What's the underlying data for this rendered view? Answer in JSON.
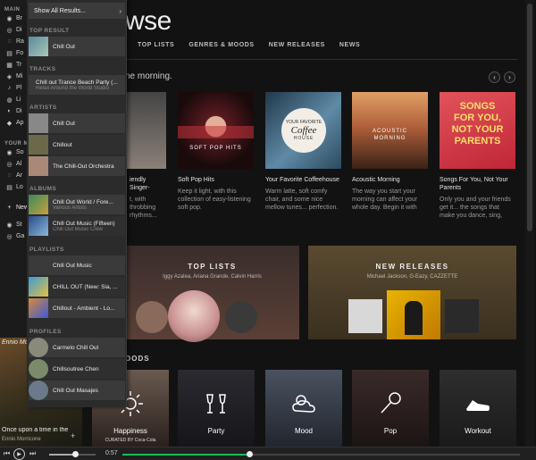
{
  "rail": {
    "main_label": "MAIN",
    "main_items": [
      "Br",
      "Di",
      "Ra",
      "Fo",
      "Tr",
      "Mi",
      "Pl",
      "Li",
      "Di",
      "Ap"
    ],
    "your_music_label": "YOUR M",
    "your_music_items": [
      "So",
      "Al",
      "Ar",
      "Lo"
    ],
    "new_label": "New",
    "extra_items": [
      "St",
      "Ga"
    ]
  },
  "browse": {
    "title": "wse",
    "tabs": [
      "TOP LISTS",
      "GENRES & MOODS",
      "NEW RELEASES",
      "NEWS"
    ],
    "section_heading": "he morning.",
    "prev_icon": "chevron-left-icon",
    "next_icon": "chevron-right-icon"
  },
  "cards": [
    {
      "title": "iendly Singer-",
      "desc": "t, with\nthrobbing\nrhythms...",
      "art_text": "",
      "art_colors": [
        "#2a2a2a",
        "#8a7a6a"
      ]
    },
    {
      "title": "Soft Pop Hits",
      "desc": "Keep it light, with this collection of easy-listening soft pop.",
      "art_text": "SOFT POP HITS",
      "art_colors": [
        "#3a1015",
        "#c8343c"
      ]
    },
    {
      "title": "Your Favorite Coffeehouse",
      "desc": "Warm latte, soft comfy chair, and some nice mellow tunes... perfection.",
      "art_text_top": "YOUR FAVORITE",
      "art_text_mid": "Coffee",
      "art_text_bot": "HOUSE",
      "art_colors": [
        "#1d2e3d",
        "#4a7a9a"
      ]
    },
    {
      "title": "Acoustic Morning",
      "desc": "The way you start your morning can affect your whole day. Begin it with",
      "art_text": "ACOUSTIC MORNING",
      "art_colors": [
        "#3a2418",
        "#c4805a"
      ]
    },
    {
      "title": "Songs For You, Not Your Parents",
      "desc": "Only you and your friends get it... the songs that make you dance, sing,",
      "art_lines": [
        "SONGS",
        "FOR YOU,",
        "NOT YOUR",
        "PARENTS"
      ],
      "art_colors": [
        "#c8253a",
        "#e85a5a"
      ]
    }
  ],
  "banners": [
    {
      "title": "TOP LISTS",
      "sub": "Iggy Azalea, Ariana Grande, Calvin Harris"
    },
    {
      "title": "NEW RELEASES",
      "sub": "Michael Jackson, G-Eazy, CAZZETTE"
    }
  ],
  "moods": {
    "heading": "OODS",
    "items": [
      {
        "label": "Happiness",
        "sub": "CURATED BY Coca-Cola",
        "icon": "sun-icon"
      },
      {
        "label": "Party",
        "icon": "glasses-icon"
      },
      {
        "label": "Mood",
        "icon": "cloud-sun-icon"
      },
      {
        "label": "Pop",
        "icon": "microphone-icon"
      },
      {
        "label": "Workout",
        "icon": "shoe-icon"
      }
    ]
  },
  "panel": {
    "show_all": "Show All Results...",
    "sections": {
      "top_result": "TOP RESULT",
      "tracks": "TRACKS",
      "artists": "ARTISTS",
      "albums": "ALBUMS",
      "playlists": "PLAYLISTS",
      "profiles": "PROFILES"
    },
    "top_result": [
      {
        "t1": "Chill Out",
        "t2": ""
      }
    ],
    "tracks": [
      {
        "t1": "Chill out Trance Beach Party (...",
        "t2": "Relax Around the World Studio"
      }
    ],
    "artists": [
      {
        "t1": "Chill Out"
      },
      {
        "t1": "Chillout"
      },
      {
        "t1": "The Chill-Out Orchestra"
      }
    ],
    "albums": [
      {
        "t1": "Chill Out World / Fore...",
        "t2": "Various Artists"
      },
      {
        "t1": "Chill Out Music (Fifteen)",
        "t2": "Chill Out Music Crew"
      }
    ],
    "playlists": [
      {
        "t1": "Chill Out Music"
      },
      {
        "t1": "CHILL OUT (New: Sia, ..."
      },
      {
        "t1": "Chillout - Ambient - Lo..."
      }
    ],
    "profiles": [
      {
        "t1": "Carmelo Chill Out"
      },
      {
        "t1": "Chillsoutree Chen"
      },
      {
        "t1": "Chill Out Masajes"
      }
    ]
  },
  "now_playing": {
    "tag": "Ennio Mo",
    "title": "Once upon a time in the ",
    "artist": "Ennio Morricone",
    "add_icon": "plus-icon"
  },
  "player": {
    "elapsed": "0:57",
    "volume_fraction": 0.55,
    "progress_fraction": 0.32
  }
}
